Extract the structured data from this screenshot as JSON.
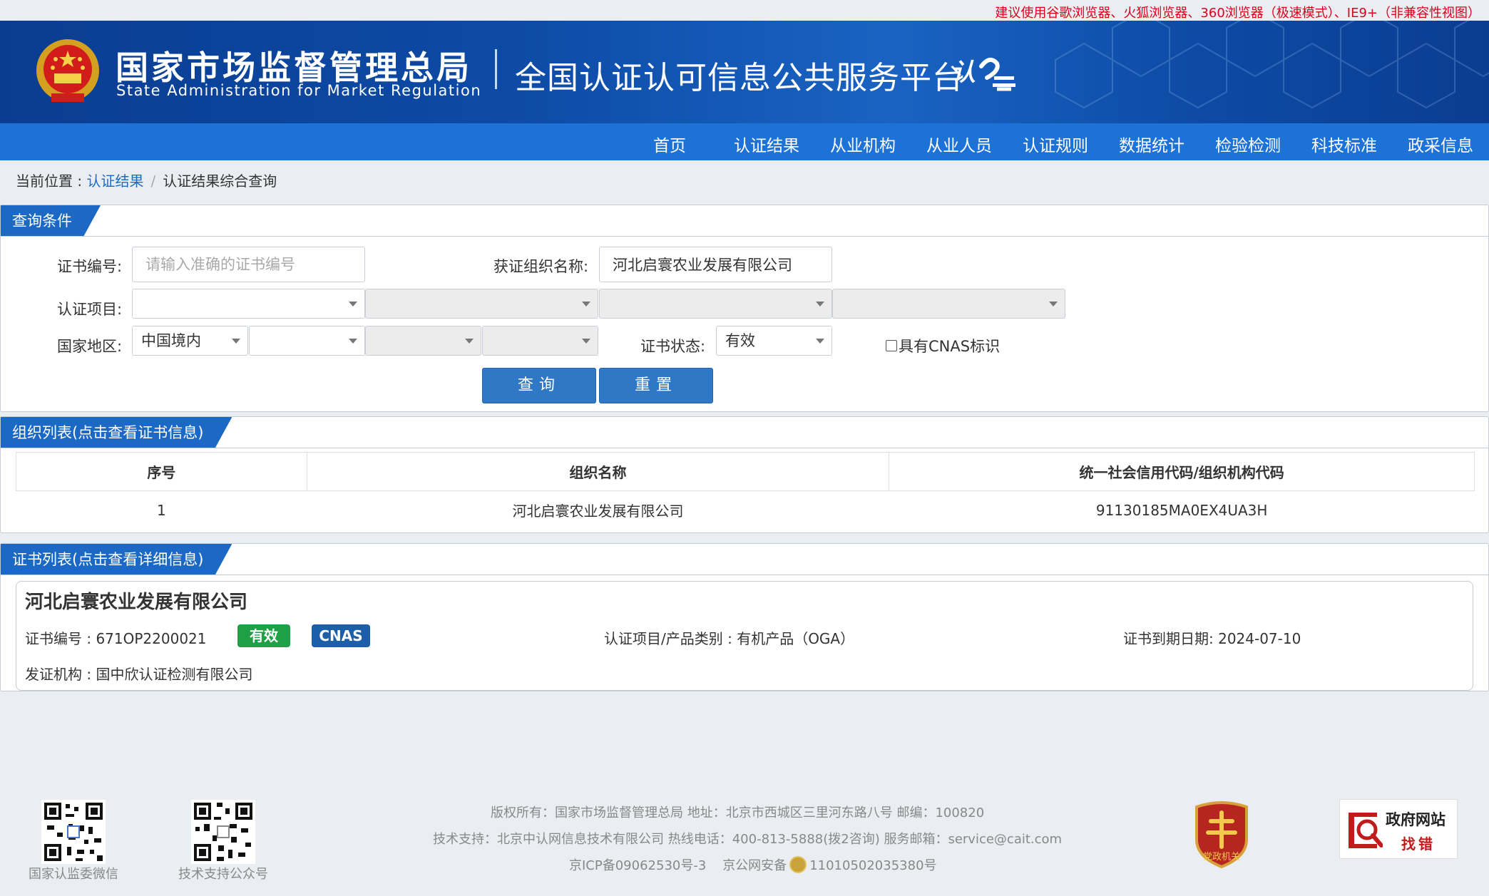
{
  "top_notice": "建议使用谷歌浏览器、火狐浏览器、360浏览器（极速模式）、IE9+（非兼容性视图）",
  "header": {
    "org_name_cn": "国家市场监督管理总局",
    "org_name_en": "State Administration  for  Market Regulation",
    "platform_title": "全国认证认可信息公共服务平台",
    "platform_logo_text": "认云"
  },
  "nav": {
    "items": [
      "首页",
      "认证结果",
      "从业机构",
      "从业人员",
      "认证规则",
      "数据统计",
      "检验检测",
      "科技标准",
      "政采信息"
    ]
  },
  "breadcrumb": {
    "prefix": "当前位置 : ",
    "level1": "认证结果",
    "separator": "/",
    "level2": "认证结果综合查询"
  },
  "query": {
    "title": "查询条件",
    "cert_no_label": "证书编号:",
    "cert_no_placeholder": "请输入准确的证书编号",
    "cert_no_value": "",
    "org_name_label": "获证组织名称:",
    "org_name_value": "河北启寰农业发展有限公司",
    "project_label": "认证项目:",
    "project_selects": [
      "",
      "",
      "",
      ""
    ],
    "region_label": "国家地区:",
    "region_selects": [
      "中国境内",
      "",
      "",
      ""
    ],
    "status_label": "证书状态:",
    "status_value": "有效",
    "cnas_checkbox_label": "具有CNAS标识",
    "cnas_checked": false,
    "search_button": "查询",
    "reset_button": "重置"
  },
  "org_list": {
    "title": "组织列表(点击查看证书信息)",
    "columns": [
      "序号",
      "组织名称",
      "统一社会信用代码/组织机构代码"
    ],
    "rows": [
      [
        "1",
        "河北启寰农业发展有限公司",
        "91130185MA0EX4UA3H"
      ]
    ]
  },
  "cert_list": {
    "title": "证书列表(点击查看详细信息)",
    "items": [
      {
        "org_name": "河北启寰农业发展有限公司",
        "cert_no_text": "证书编号 : 671OP2200021",
        "status_badge": "有效",
        "status_color": "#20a046",
        "cnas_badge": "CNAS",
        "cnas_color": "#1c5fa8",
        "project_text": "认证项目/产品类别 : 有机产品（OGA）",
        "expiry_text": "证书到期日期: 2024-07-10",
        "issuer_text": "发证机构 : 国中欣认证检测有限公司"
      }
    ]
  },
  "footer": {
    "qr1_label": "国家认监委微信",
    "qr2_label": "技术支持公众号",
    "line1": "版权所有：国家市场监督管理总局    地址：北京市西城区三里河东路八号    邮编：100820",
    "line2": "技术支持：北京中认网信息技术有限公司    热线电话：400-813-5888(拨2咨询)    服务邮箱：service@cait.com",
    "icp": "京ICP备09062530号-3",
    "police_record": "京公网安备",
    "police_no": "11010502035380号",
    "party_badge_text": "党政机关",
    "gov_site_line1": "政府网站",
    "gov_site_line2": "找错"
  },
  "colors": {
    "nav_blue": "#1c72d6",
    "panel_title_blue": "#1c68c5",
    "button_blue": "#2f78c6",
    "notice_red": "#d9001b"
  }
}
